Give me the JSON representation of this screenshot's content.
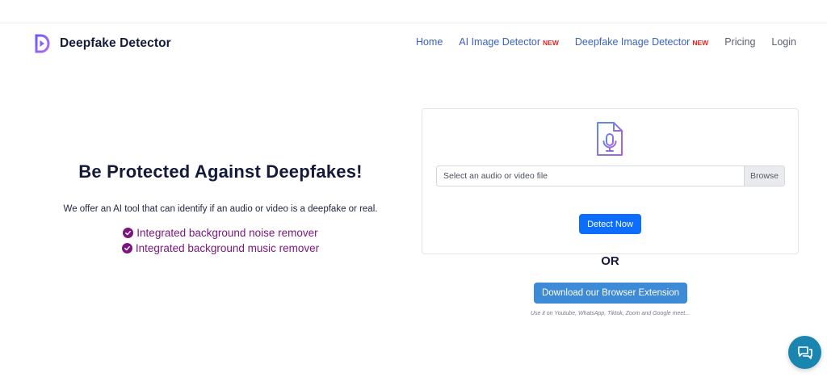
{
  "brand": {
    "name": "Deepfake Detector",
    "logo_icon": "play-d-logo-icon"
  },
  "nav": {
    "items": [
      {
        "label": "Home",
        "badge": ""
      },
      {
        "label": "AI Image Detector",
        "badge": "NEW"
      },
      {
        "label": "Deepfake Image Detector",
        "badge": "NEW"
      },
      {
        "label": "Pricing",
        "badge": ""
      },
      {
        "label": "Login",
        "badge": ""
      }
    ]
  },
  "hero": {
    "title": "Be Protected Against Deepfakes!",
    "subtitle": "We offer an AI tool that can identify if an audio or video is a deepfake or real.",
    "features": [
      "Integrated background noise remover",
      "Integrated background music remover"
    ]
  },
  "upload": {
    "icon": "audio-file-icon",
    "placeholder": "Select an audio or video file",
    "browse_label": "Browse",
    "detect_label": "Detect Now"
  },
  "alt": {
    "or_label": "OR",
    "extension_label": "Download our Browser Extension",
    "extension_note": "Use it on Youtube, WhatsApp, Tiktok, Zoom and Google meet..."
  },
  "colors": {
    "accent": "#0d6efd",
    "nav_link": "#3a62c5",
    "feature": "#7b157e",
    "badge": "#e02424",
    "chat": "#1a86b0"
  }
}
